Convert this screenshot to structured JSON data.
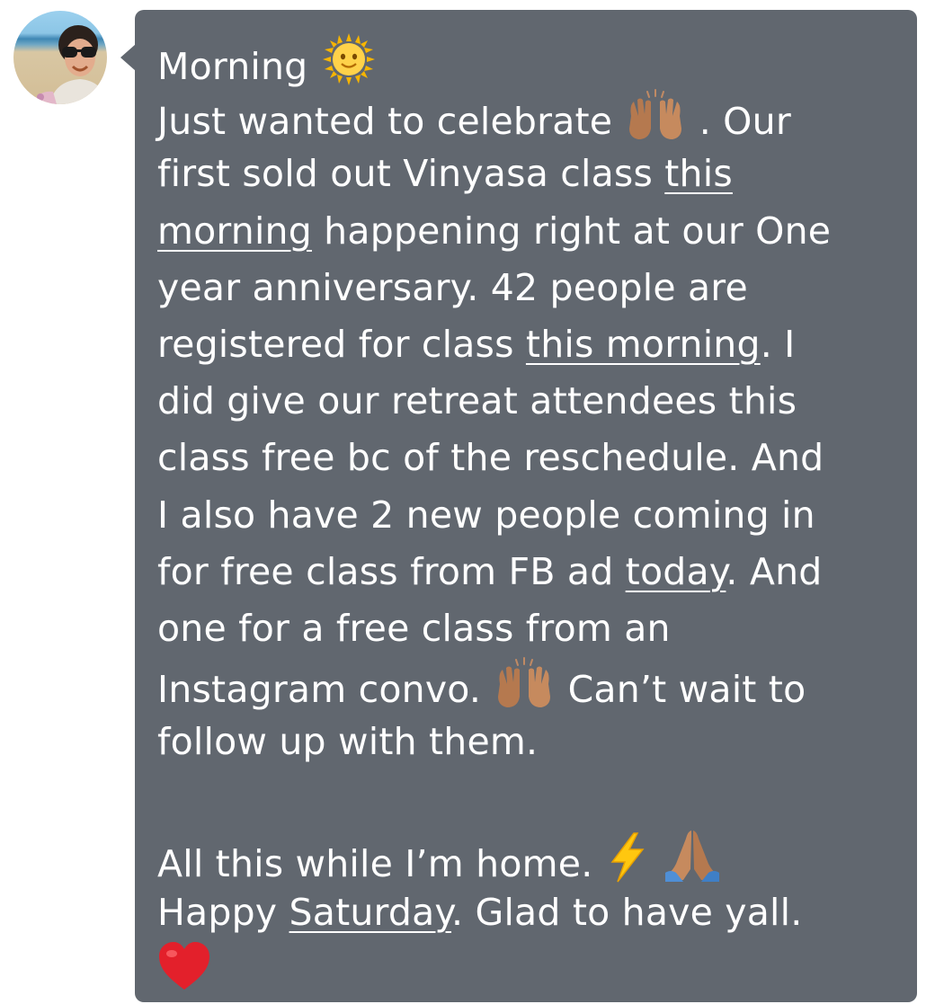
{
  "sender": {
    "avatar_icon": "profile-photo-icon"
  },
  "message": {
    "bubble_color": "#61676f",
    "text_color": "#ffffff",
    "line1_text": "Morning",
    "line1_emoji": "sun-with-face-icon",
    "line2_text": "Just wanted to celebrate",
    "line2_emoji": "raising-hands-icon",
    "line2_tail": ". Our",
    "line3_text": "first sold out Vinyasa class",
    "line3_link": "this",
    "line4_link": "morning",
    "line4_text": " happening right at our One",
    "line5_text": "year anniversary. 42 people are",
    "line6_text": "registered for class",
    "line6_link": "this morning",
    "line6_tail": ". I",
    "line7_text": "did give our retreat attendees this",
    "line8_text": "class free bc of the reschedule. And",
    "line9_text": "I also have 2 new people coming in",
    "line10_text": "for free class from FB ad",
    "line10_link": "today",
    "line10_tail": ". And",
    "line11_text": "one for a free class from an",
    "line12_text": "Instagram convo.",
    "line12_emoji": "raising-hands-icon",
    "line12_tail": "Can’t wait to",
    "line13_text": "follow up with them.",
    "line15_text": "All this while I’m home.",
    "line15_emoji1": "high-voltage-icon",
    "line15_emoji2": "folded-hands-icon",
    "line16_text": "Happy",
    "line16_link": "Saturday",
    "line16_tail": ". Glad to have yall.",
    "line17_emoji": "red-heart-icon"
  }
}
